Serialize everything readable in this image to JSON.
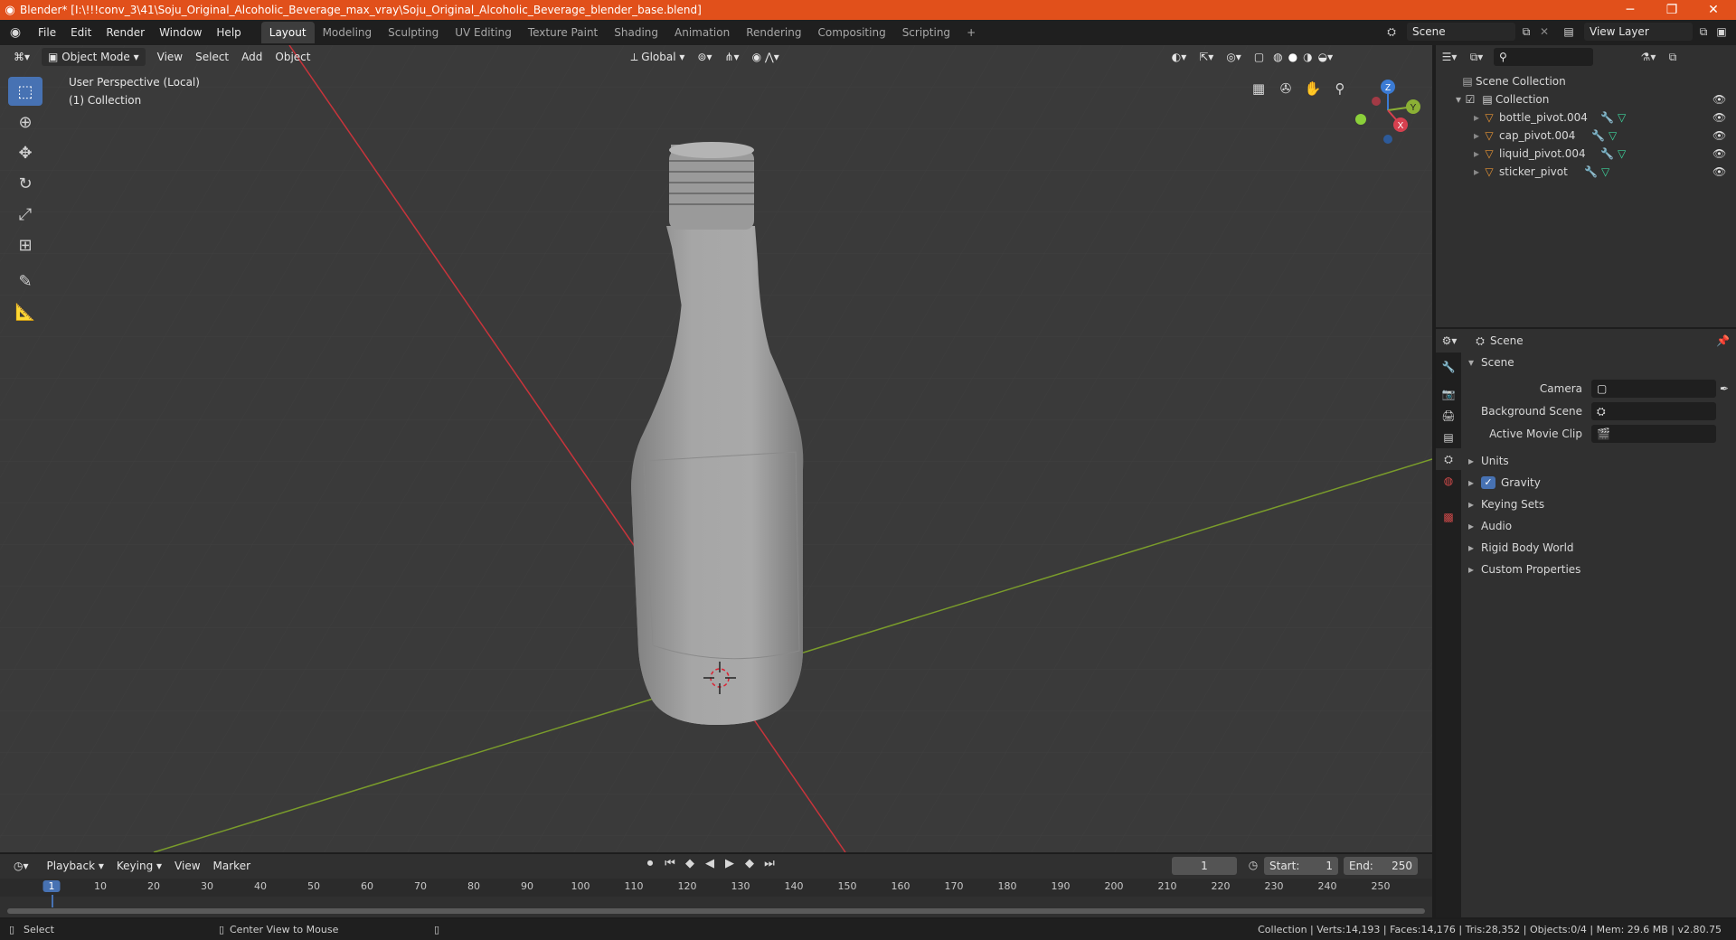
{
  "window": {
    "title": "Blender* [I:\\!!!conv_3\\41\\Soju_Original_Alcoholic_Beverage_max_vray\\Soju_Original_Alcoholic_Beverage_blender_base.blend]",
    "minimize": "─",
    "maximize": "❐",
    "close": "✕"
  },
  "menu": [
    "File",
    "Edit",
    "Render",
    "Window",
    "Help"
  ],
  "workspaces": [
    "Layout",
    "Modeling",
    "Sculpting",
    "UV Editing",
    "Texture Paint",
    "Shading",
    "Animation",
    "Rendering",
    "Compositing",
    "Scripting"
  ],
  "workspace_add": "+",
  "scene_name": "Scene",
  "view_layer": "View Layer",
  "viewport_header": {
    "mode": "Object Mode",
    "menus": [
      "View",
      "Select",
      "Add",
      "Object"
    ],
    "orientation": "Global"
  },
  "overlay": {
    "perspective": "User Perspective (Local)",
    "collection": "(1) Collection"
  },
  "gizmo": {
    "z": "Z",
    "y": "Y",
    "x": "X"
  },
  "outliner": {
    "root": "Scene Collection",
    "collection": "Collection",
    "objects": [
      "bottle_pivot.004",
      "cap_pivot.004",
      "liquid_pivot.004",
      "sticker_pivot"
    ]
  },
  "properties": {
    "context": "Scene",
    "section": "Scene",
    "fields": [
      {
        "label": "Camera"
      },
      {
        "label": "Background Scene"
      },
      {
        "label": "Active Movie Clip"
      }
    ],
    "panels": [
      "Units",
      "Gravity",
      "Keying Sets",
      "Audio",
      "Rigid Body World",
      "Custom Properties"
    ],
    "gravity_checked": true
  },
  "timeline": {
    "menus": [
      "Playback",
      "Keying",
      "View",
      "Marker"
    ],
    "current_frame": "1",
    "start_label": "Start:",
    "start": "1",
    "end_label": "End:",
    "end": "250",
    "ticks": [
      "1",
      "10",
      "20",
      "30",
      "40",
      "50",
      "60",
      "70",
      "80",
      "90",
      "100",
      "110",
      "120",
      "130",
      "140",
      "150",
      "160",
      "170",
      "180",
      "190",
      "200",
      "210",
      "220",
      "230",
      "240",
      "250"
    ]
  },
  "status": {
    "left": "Select",
    "middle": "Center View to Mouse",
    "right": "Collection | Verts:14,193 | Faces:14,176 | Tris:28,352 | Objects:0/4 | Mem: 29.6 MB | v2.80.75"
  },
  "colors": {
    "titlebar": "#e1501b",
    "accent": "#4772b3",
    "x_axis": "#c8343b",
    "y_axis": "#7a9c2b"
  }
}
